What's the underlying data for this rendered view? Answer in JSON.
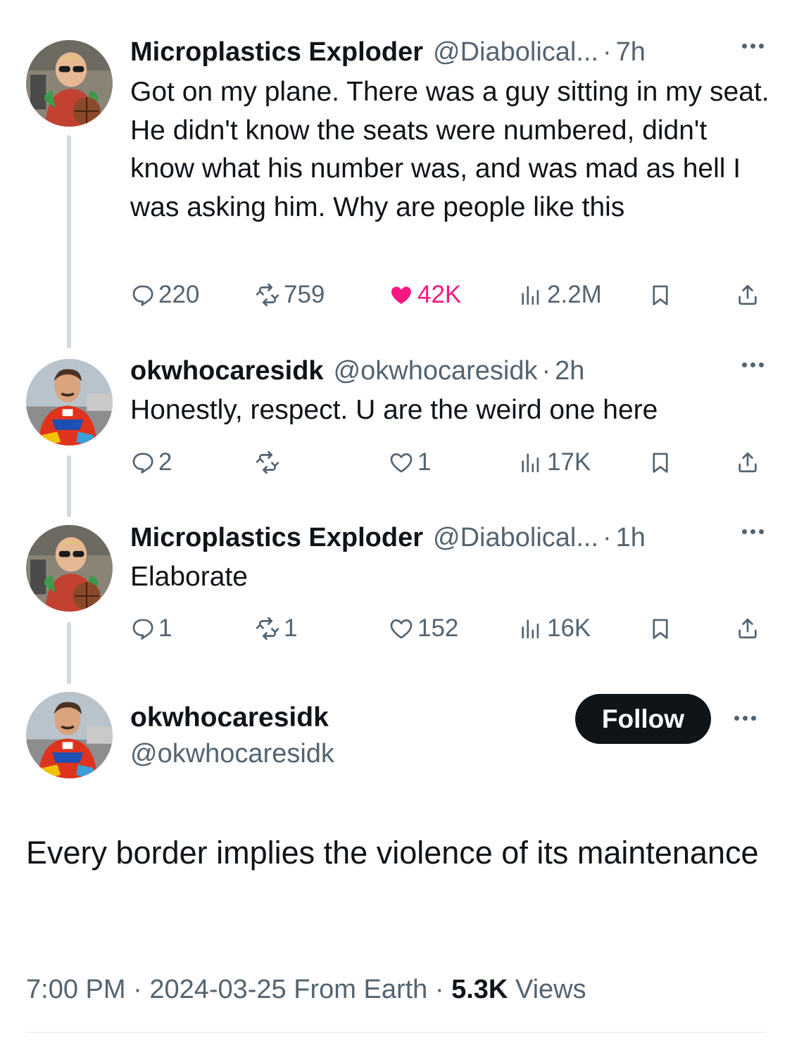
{
  "thread": [
    {
      "display_name": "Microplastics Exploder",
      "handle": "@Diabolical...",
      "time": "7h",
      "text": "Got on my plane. There was a guy sitting in my seat. He didn't know the seats were numbered, didn't know what his number was, and was mad as hell I was asking him. Why are people like this",
      "avatar": "avatar-basketball-player",
      "stats": {
        "replies": "220",
        "reposts": "759",
        "likes": "42K",
        "views": "2.2M"
      },
      "liked": true
    },
    {
      "display_name": "okwhocaresidk",
      "handle": "@okwhocaresidk",
      "time": "2h",
      "text": "Honestly, respect. U are the weird one here",
      "avatar": "avatar-race-driver",
      "stats": {
        "replies": "2",
        "reposts": "",
        "likes": "1",
        "views": "17K"
      },
      "liked": false
    },
    {
      "display_name": "Microplastics Exploder",
      "handle": "@Diabolical...",
      "time": "1h",
      "text": "Elaborate",
      "avatar": "avatar-basketball-player",
      "stats": {
        "replies": "1",
        "reposts": "1",
        "likes": "152",
        "views": "16K"
      },
      "liked": false
    }
  ],
  "main_tweet": {
    "display_name": "okwhocaresidk",
    "handle": "@okwhocaresidk",
    "follow_label": "Follow",
    "text": "Every border implies the violence of its maintenance",
    "time": "7:00 PM",
    "date": "2024-03-25",
    "source": "From Earth",
    "views_count": "5.3K",
    "views_label": "Views"
  },
  "colors": {
    "like_pink": "#f91880",
    "secondary_text": "#536471",
    "primary_text": "#0f1419",
    "thread_line": "#cfd9de"
  }
}
